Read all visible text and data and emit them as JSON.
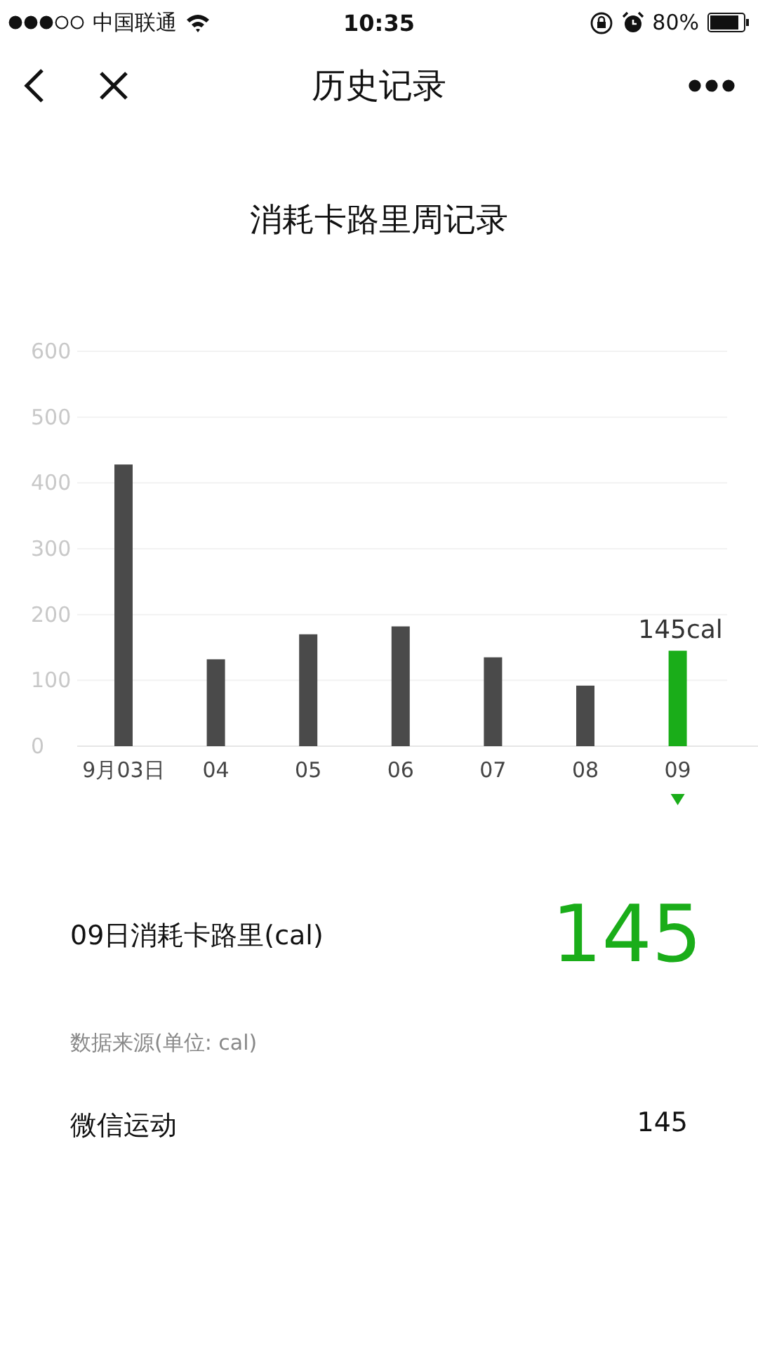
{
  "status_bar": {
    "carrier": "中国联通",
    "time": "10:35",
    "battery": "80%"
  },
  "nav": {
    "title": "历史记录"
  },
  "chart_title": "消耗卡路里周记录",
  "chart_data": {
    "type": "bar",
    "categories": [
      "9月03日",
      "04",
      "05",
      "06",
      "07",
      "08",
      "09"
    ],
    "series": [
      {
        "color": "#4a4a4a",
        "values": [
          428,
          132,
          170,
          182,
          135,
          92,
          null
        ]
      },
      {
        "color": "#1aad19",
        "values": [
          null,
          null,
          null,
          null,
          null,
          null,
          145
        ]
      }
    ],
    "grid": true,
    "ylim": [
      0,
      600
    ],
    "yticks": [
      0,
      100,
      200,
      300,
      400,
      500,
      600
    ],
    "annotations": [
      {
        "x": "09",
        "y": 145,
        "text": "145cal"
      }
    ]
  },
  "detail": {
    "label": "09日消耗卡路里(cal)",
    "value": "145"
  },
  "source_heading": "数据来源(单位: cal)",
  "sources": [
    {
      "name": "微信运动",
      "value": "145"
    }
  ]
}
